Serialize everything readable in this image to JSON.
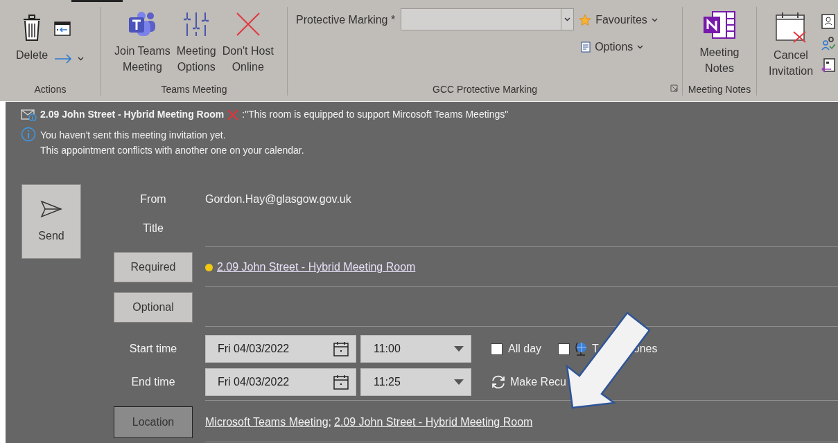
{
  "ribbon": {
    "groups": [
      {
        "kind": "actions",
        "label": "Actions",
        "buttons": [
          {
            "label": "Delete"
          }
        ]
      },
      {
        "kind": "buttons",
        "label": "Teams Meeting",
        "buttons": [
          {
            "label": "Join Teams Meeting"
          },
          {
            "label": "Meeting Options"
          },
          {
            "label": "Don't Host Online"
          }
        ]
      },
      {
        "kind": "marking",
        "label": "GCC Protective Marking",
        "field_label": "Protective Marking *",
        "menus": [
          "Favourites",
          "Options"
        ]
      },
      {
        "kind": "buttons",
        "label": "Meeting Notes",
        "buttons": [
          {
            "label": "Meeting Notes"
          }
        ]
      },
      {
        "kind": "buttons",
        "buttons": [
          {
            "label": "Cancel Invitation"
          }
        ]
      }
    ]
  },
  "banner": {
    "room": "2.09 John Street - Hybrid Meeting Room",
    "note": ":\"This room is equipped to support Mircosoft Teams Meetings\"",
    "info": [
      "You haven't sent this meeting invitation yet.",
      "This appointment conflicts with another one on your calendar."
    ]
  },
  "send_button": "Send",
  "form": {
    "from_label": "From",
    "from": "Gordon.Hay@glasgow.gov.uk",
    "title_label": "Title",
    "required_button": "Required",
    "required": [
      {
        "name": "2.09 John Street - Hybrid Meeting Room",
        "color": "#f2c811"
      }
    ],
    "optional_button": "Optional",
    "start_label": "Start time",
    "start_date": "Fri 04/03/2022",
    "start_time": "11:00",
    "end_label": "End time",
    "end_date": "Fri 04/03/2022",
    "end_time": "11:25",
    "all_day": {
      "label": "All day",
      "checked": false
    },
    "time_zones": {
      "label_before": "T",
      "label_after": "ones",
      "checked": false
    },
    "recurrence": "Make Recu",
    "location_button": "Location",
    "location": [
      "Microsoft Teams Meeting",
      "2.09 John Street - Hybrid Meeting Room"
    ],
    "location_separator": ";"
  }
}
